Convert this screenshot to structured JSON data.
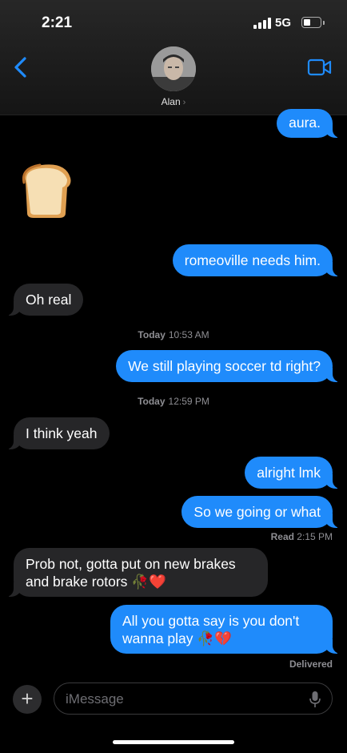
{
  "status_bar": {
    "time": "2:21",
    "network": "5G"
  },
  "header": {
    "contact_name": "Alan",
    "chevron": "›"
  },
  "messages": [
    {
      "dir": "sent",
      "text": "aura."
    },
    {
      "dir": "recv",
      "text": "🍞",
      "kind": "emoji-only"
    },
    {
      "dir": "sent",
      "text": "romeoville needs him."
    },
    {
      "dir": "recv",
      "text": "Oh real"
    },
    {
      "dir": "sent",
      "text": "We still playing soccer td right?"
    },
    {
      "dir": "recv",
      "text": "I think yeah"
    },
    {
      "dir": "sent",
      "text": "alright lmk"
    },
    {
      "dir": "sent",
      "text": "So we going or what"
    },
    {
      "dir": "recv",
      "text": "Prob not, gotta put on new brakes and brake rotors 🥀❤️"
    },
    {
      "dir": "sent",
      "text": "All you gotta say is you don't wanna play 🥀💔"
    }
  ],
  "timestamps": [
    {
      "day": "Today",
      "time": "10:53 AM"
    },
    {
      "day": "Today",
      "time": "12:59 PM"
    }
  ],
  "read_receipt": {
    "label": "Read",
    "time": "2:15 PM"
  },
  "delivered_label": "Delivered",
  "compose": {
    "placeholder": "iMessage",
    "add_symbol": "+"
  },
  "icons": {
    "back": "chevron-left-icon",
    "video": "video-camera-icon",
    "mic": "microphone-icon",
    "add": "plus-icon"
  },
  "colors": {
    "sent_bubble": "#1f8bfb",
    "received_bubble": "#262628",
    "accent": "#1f8bfb"
  }
}
